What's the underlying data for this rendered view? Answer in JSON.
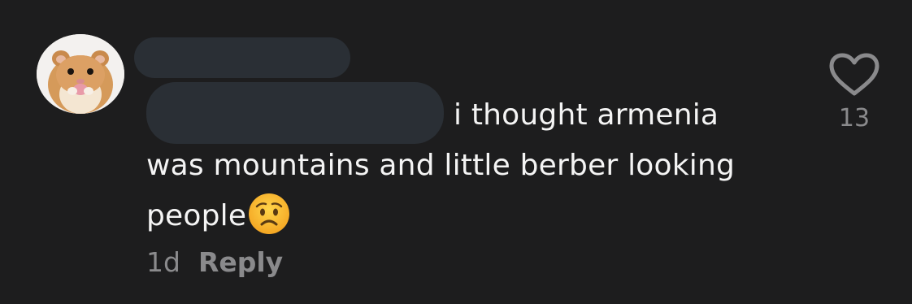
{
  "comment": {
    "avatar_icon": "hamster-avatar",
    "text_line1": "i thought armenia",
    "text_line2": "was mountains and little berber looking",
    "text_line3": "people",
    "emoji": "worried-face-emoji",
    "time": "1d",
    "reply_label": "Reply",
    "like_icon": "heart-outline-icon",
    "like_count": "13"
  },
  "colors": {
    "background": "#1d1d1e",
    "text": "#f4f4f4",
    "muted": "#8a8a8c",
    "redaction": "#2a2f35"
  }
}
